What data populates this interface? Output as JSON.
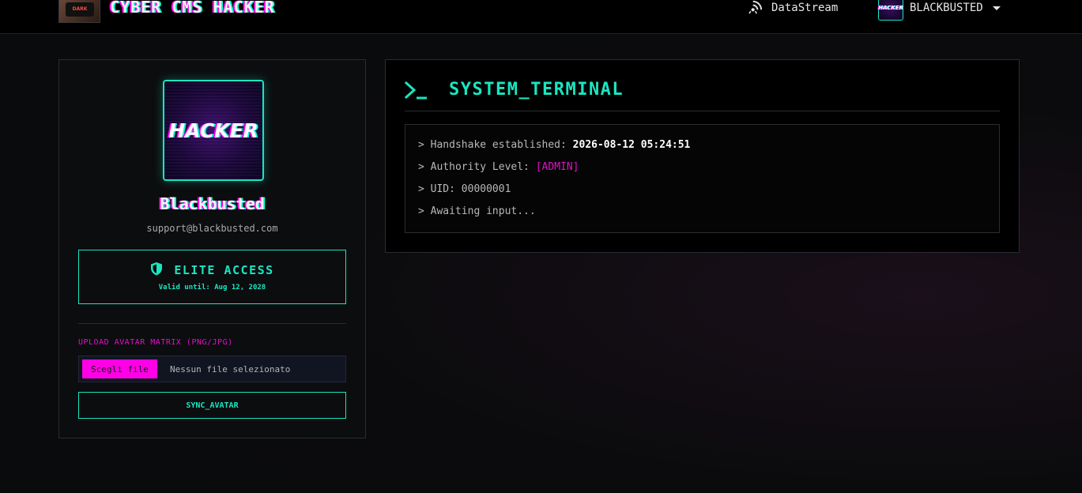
{
  "nav": {
    "logo_text": "DARK",
    "brand_title": "CYBER CMS HACKER",
    "datastream_label": "DataStream",
    "user_avatar_text": "HACKER",
    "username": "BLACKBUSTED"
  },
  "profile": {
    "avatar_text": "HACKER",
    "name": "Blackbusted",
    "email": "support@blackbusted.com",
    "access_title": "ELITE ACCESS",
    "access_valid": "Valid until: Aug 12, 2028",
    "upload_label": "UPLOAD AVATAR MATRIX (PNG/JPG)",
    "file_button_label": "Scegli file",
    "file_status": "Nessun file selezionato",
    "sync_button_label": "SYNC_AVATAR"
  },
  "terminal": {
    "title": "SYSTEM_TERMINAL",
    "lines": [
      {
        "prefix": "> Handshake established: ",
        "value": "2026-08-12 05:24:51"
      },
      {
        "prefix": "> Authority Level: ",
        "value": "[ADMIN]"
      },
      {
        "prefix": "> UID: 00000001"
      },
      {
        "prefix": "> Awaiting input..."
      }
    ]
  },
  "colors": {
    "accent_cyan": "#19e6c1",
    "accent_magenta": "#ff00e6",
    "background": "#0b0b0d"
  },
  "icons": {
    "datastream": "broadcast-icon",
    "access": "shield-icon",
    "terminal": "terminal-prompt-icon",
    "user_menu": "caret-down-icon"
  }
}
